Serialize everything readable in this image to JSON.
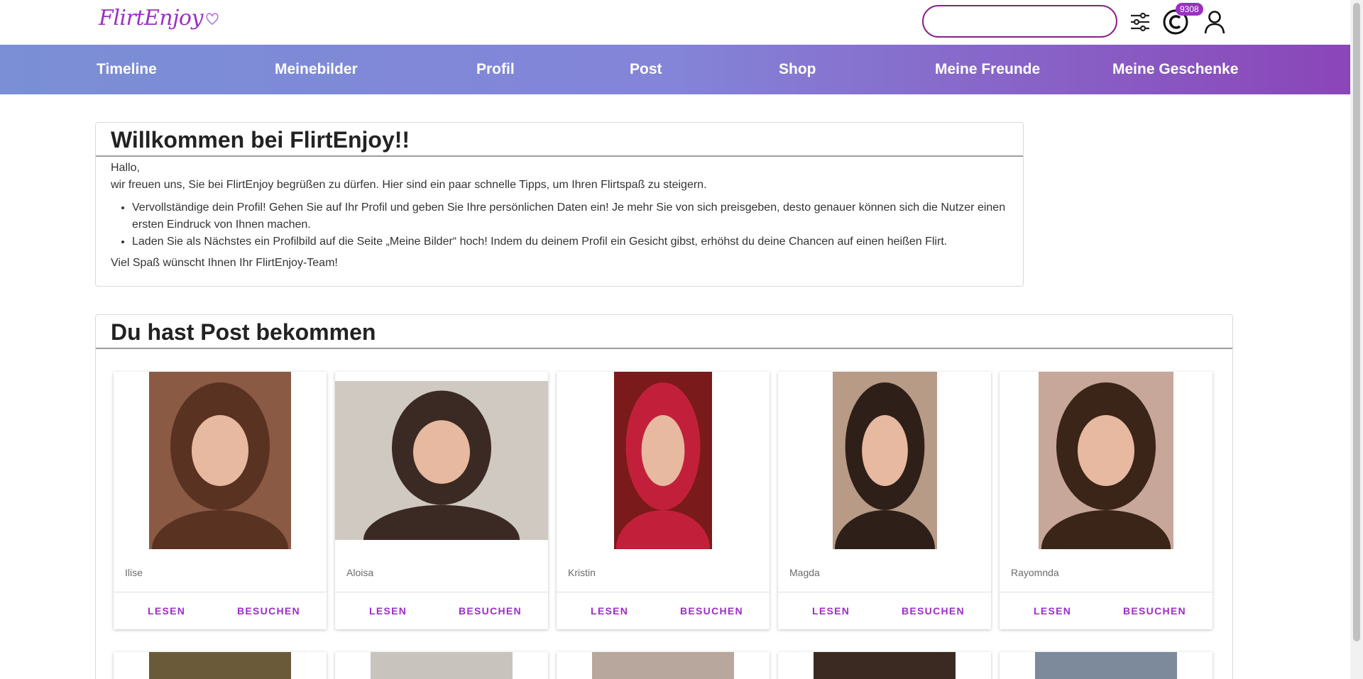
{
  "brand": {
    "logo_text": "FlirtEnjoy",
    "color": "#9b2fc4"
  },
  "header": {
    "search_placeholder": "",
    "coin_count": "9308"
  },
  "nav": {
    "items": [
      {
        "label": "Timeline"
      },
      {
        "label": "Meinebilder"
      },
      {
        "label": "Profil"
      },
      {
        "label": "Post"
      },
      {
        "label": "Shop"
      },
      {
        "label": "Meine Freunde"
      },
      {
        "label": "Meine Geschenke"
      }
    ]
  },
  "welcome": {
    "title": "Willkommen bei FlirtEnjoy!!",
    "greeting": "Hallo,",
    "intro": "wir freuen uns, Sie bei FlirtEnjoy begrüßen zu dürfen. Hier sind ein paar schnelle Tipps, um Ihren Flirtspaß zu steigern.",
    "tips": [
      "Vervollständige dein Profil! Gehen Sie auf Ihr Profil und geben Sie Ihre persönlichen Daten ein! Je mehr Sie von sich preisgeben, desto genauer können sich die Nutzer einen ersten Eindruck von Ihnen machen.",
      "Laden Sie als Nächstes ein Profilbild auf die Seite „Meine Bilder“ hoch! Indem du deinem Profil ein Gesicht gibst, erhöhst du deine Chancen auf einen heißen Flirt."
    ],
    "closing": "Viel Spaß wünscht Ihnen Ihr FlirtEnjoy-Team!"
  },
  "post": {
    "title": "Du hast Post bekommen",
    "read_label": "LESEN",
    "visit_label": "BESUCHEN",
    "cards": [
      {
        "name": "Ilise",
        "photo_color": "#8a5a44",
        "hair": "#5a3222"
      },
      {
        "name": "Aloisa",
        "photo_color": "#cfc9c2",
        "hair": "#3b2a23"
      },
      {
        "name": "Kristin",
        "photo_color": "#7a1a1a",
        "hair": "#c2203a"
      },
      {
        "name": "Magda",
        "photo_color": "#b79b86",
        "hair": "#2e2018"
      },
      {
        "name": "Rayomnda",
        "photo_color": "#c7a79a",
        "hair": "#3a2518"
      }
    ]
  }
}
